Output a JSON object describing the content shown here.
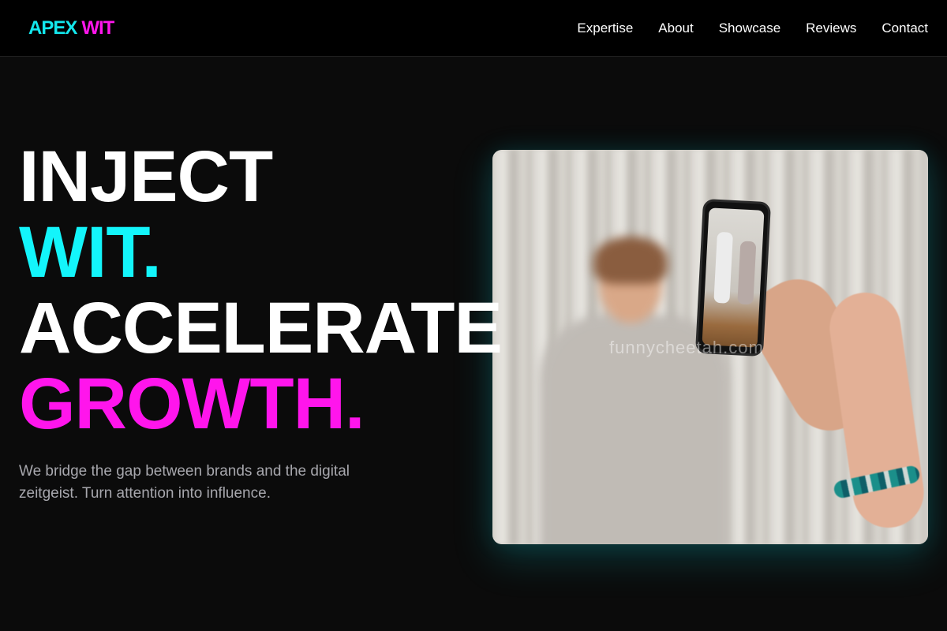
{
  "brand": {
    "logo_part1": "APEX",
    "logo_part2": "WIT",
    "colors": {
      "cyan": "#13f5fb",
      "magenta": "#ff15ec"
    }
  },
  "nav": {
    "items": [
      {
        "label": "Expertise"
      },
      {
        "label": "About"
      },
      {
        "label": "Showcase"
      },
      {
        "label": "Reviews"
      },
      {
        "label": "Contact"
      }
    ]
  },
  "hero": {
    "line1": "INJECT",
    "line2": "WIT.",
    "line3": "ACCELERATE",
    "line4": "GROWTH.",
    "subtext": "We bridge the gap between brands and the digital zeitgeist. Turn attention into influence."
  },
  "media": {
    "image_label": "person filming dancers with smartphone",
    "watermark": "funnycheetah.com"
  }
}
